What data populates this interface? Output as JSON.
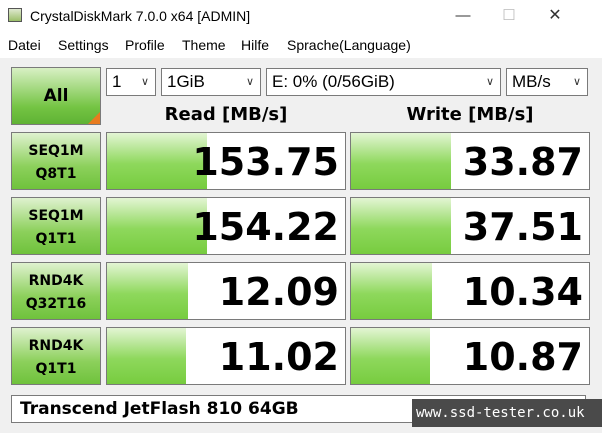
{
  "window": {
    "title": "CrystalDiskMark 7.0.0 x64 [ADMIN]",
    "minimize": "—",
    "maximize": "☐",
    "close": "✕"
  },
  "menu": [
    "Datei",
    "Settings",
    "Profile",
    "Theme",
    "Hilfe",
    "Sprache(Language)"
  ],
  "controls": {
    "all_label": "All",
    "count": "1",
    "size": "1GiB",
    "drive": "E: 0% (0/56GiB)",
    "unit": "MB/s"
  },
  "headers": {
    "read": "Read [MB/s]",
    "write": "Write [MB/s]"
  },
  "rows": [
    {
      "line1": "SEQ1M",
      "line2": "Q8T1",
      "read": "153.75",
      "write": "33.87",
      "read_fill": 0.42,
      "write_fill": 0.42
    },
    {
      "line1": "SEQ1M",
      "line2": "Q1T1",
      "read": "154.22",
      "write": "37.51",
      "read_fill": 0.42,
      "write_fill": 0.42
    },
    {
      "line1": "RND4K",
      "line2": "Q32T16",
      "read": "12.09",
      "write": "10.34",
      "read_fill": 0.34,
      "write_fill": 0.34
    },
    {
      "line1": "RND4K",
      "line2": "Q1T1",
      "read": "11.02",
      "write": "10.87",
      "read_fill": 0.33,
      "write_fill": 0.33
    }
  ],
  "comment": "Transcend JetFlash 810 64GB",
  "watermark": "www.ssd-tester.co.uk",
  "colors": {
    "bar_green": "#77cc3f",
    "accent_orange": "#e87b1f"
  }
}
